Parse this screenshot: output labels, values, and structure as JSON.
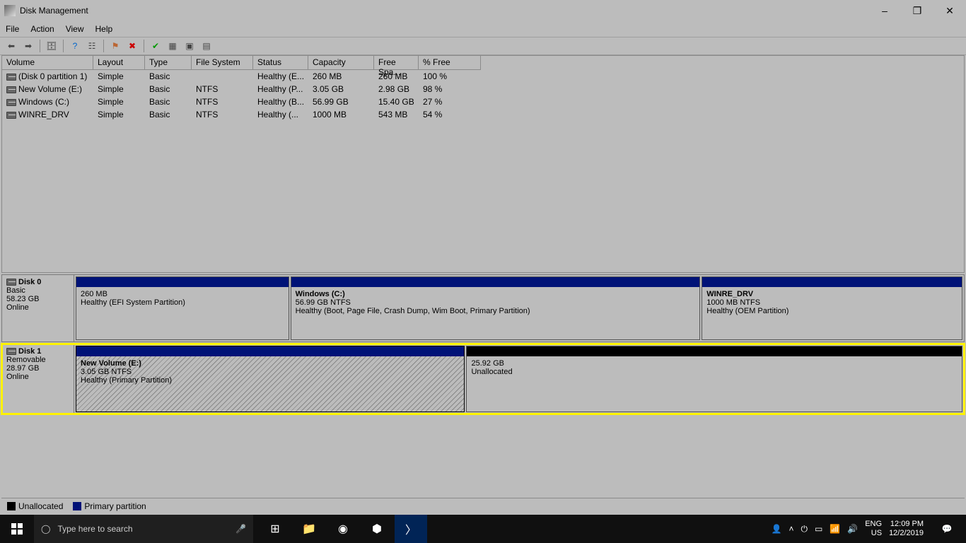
{
  "title": "Disk Management",
  "menu": [
    "File",
    "Action",
    "View",
    "Help"
  ],
  "columns": [
    "Volume",
    "Layout",
    "Type",
    "File System",
    "Status",
    "Capacity",
    "Free Spa...",
    "% Free"
  ],
  "volumes": [
    {
      "name": "(Disk 0 partition 1)",
      "layout": "Simple",
      "type": "Basic",
      "fs": "",
      "status": "Healthy (E...",
      "cap": "260 MB",
      "free": "260 MB",
      "pct": "100 %",
      "selected": false
    },
    {
      "name": "New Volume (E:)",
      "layout": "Simple",
      "type": "Basic",
      "fs": "NTFS",
      "status": "Healthy (P...",
      "cap": "3.05 GB",
      "free": "2.98 GB",
      "pct": "98 %",
      "selected": true
    },
    {
      "name": "Windows (C:)",
      "layout": "Simple",
      "type": "Basic",
      "fs": "NTFS",
      "status": "Healthy (B...",
      "cap": "56.99 GB",
      "free": "15.40 GB",
      "pct": "27 %",
      "selected": false
    },
    {
      "name": "WINRE_DRV",
      "layout": "Simple",
      "type": "Basic",
      "fs": "NTFS",
      "status": "Healthy (...",
      "cap": "1000 MB",
      "free": "543 MB",
      "pct": "54 %",
      "selected": false
    }
  ],
  "disk0": {
    "label": "Disk 0",
    "kind": "Basic",
    "size": "58.23 GB",
    "state": "Online",
    "parts": [
      {
        "title": "",
        "line1": "260 MB",
        "line2": "Healthy (EFI System Partition)",
        "flex": 300
      },
      {
        "title": "Windows  (C:)",
        "line1": "56.99 GB NTFS",
        "line2": "Healthy (Boot, Page File, Crash Dump, Wim Boot, Primary Partition)",
        "flex": 590
      },
      {
        "title": "WINRE_DRV",
        "line1": "1000 MB NTFS",
        "line2": "Healthy (OEM Partition)",
        "flex": 370
      }
    ]
  },
  "disk1": {
    "label": "Disk 1",
    "kind": "Removable",
    "size": "28.97 GB",
    "state": "Online",
    "parts": [
      {
        "title": "New Volume  (E:)",
        "line1": "3.05 GB NTFS",
        "line2": "Healthy (Primary Partition)",
        "flex": 515,
        "hatch": true,
        "selected": true
      },
      {
        "title": "",
        "line1": "25.92 GB",
        "line2": "Unallocated",
        "flex": 660,
        "unalloc": true
      }
    ]
  },
  "legend": [
    {
      "color": "#000",
      "label": "Unallocated"
    },
    {
      "color": "#001277",
      "label": "Primary partition"
    }
  ],
  "taskbar": {
    "search_placeholder": "Type here to search",
    "lang": "ENG",
    "locale": "US",
    "time": "12:09 PM",
    "date": "12/2/2019"
  }
}
